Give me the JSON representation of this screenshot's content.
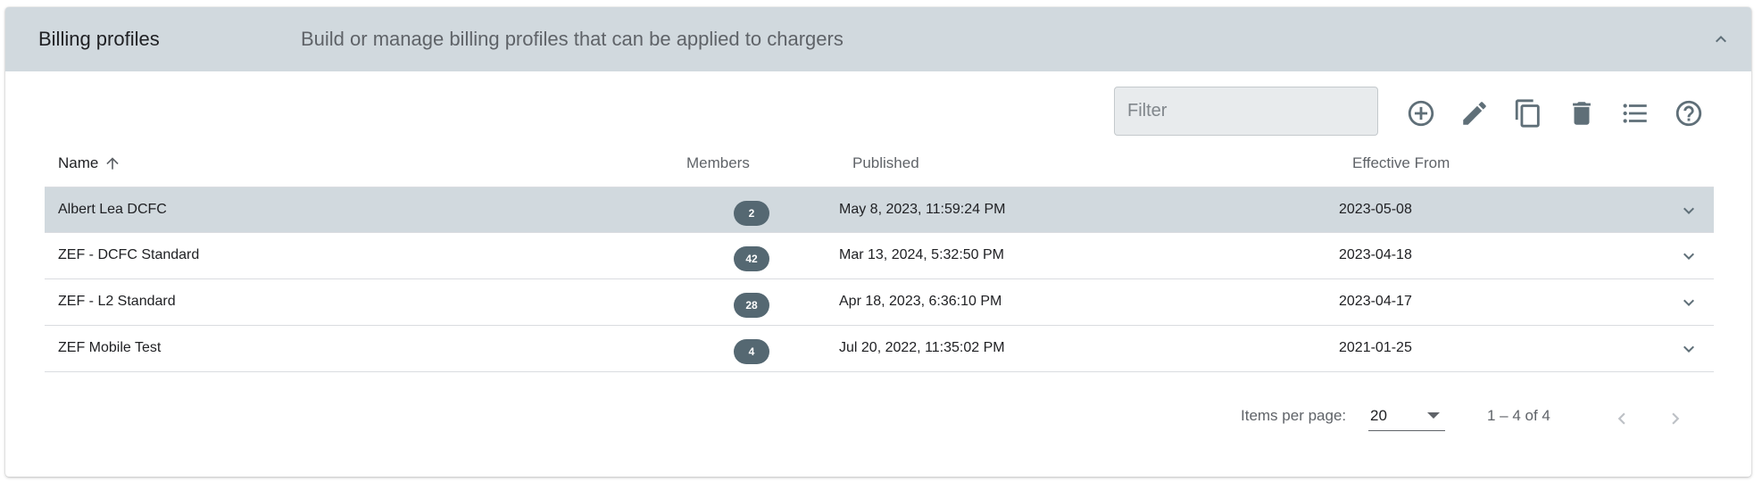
{
  "header": {
    "title": "Billing profiles",
    "description": "Build or manage billing profiles that can be applied to chargers",
    "collapse_icon": "chevron-up-icon"
  },
  "toolbar": {
    "filter_placeholder": "Filter",
    "filter_value": "",
    "icons": [
      "add-circle-icon",
      "edit-icon",
      "copy-icon",
      "delete-icon",
      "list-icon",
      "help-icon"
    ]
  },
  "table": {
    "columns": {
      "name": "Name",
      "members": "Members",
      "published": "Published",
      "effective_from": "Effective From"
    },
    "sort_icon": "arrow-up-icon",
    "rows": [
      {
        "name": "Albert Lea DCFC",
        "members": "2",
        "published": "May 8, 2023, 11:59:24 PM",
        "effective_from": "2023-05-08",
        "selected": true
      },
      {
        "name": "ZEF - DCFC Standard",
        "members": "42",
        "published": "Mar 13, 2024, 5:32:50 PM",
        "effective_from": "2023-04-18",
        "selected": false
      },
      {
        "name": "ZEF - L2 Standard",
        "members": "28",
        "published": "Apr 18, 2023, 6:36:10 PM",
        "effective_from": "2023-04-17",
        "selected": false
      },
      {
        "name": "ZEF Mobile Test",
        "members": "4",
        "published": "Jul 20, 2022, 11:35:02 PM",
        "effective_from": "2021-01-25",
        "selected": false
      }
    ]
  },
  "paginator": {
    "items_per_page_label": "Items per page:",
    "page_size": "20",
    "range_label": "1 – 4 of 4"
  },
  "colors": {
    "header_bg": "#d1d9de",
    "badge_bg": "#556872",
    "icon": "#5f6f78"
  }
}
